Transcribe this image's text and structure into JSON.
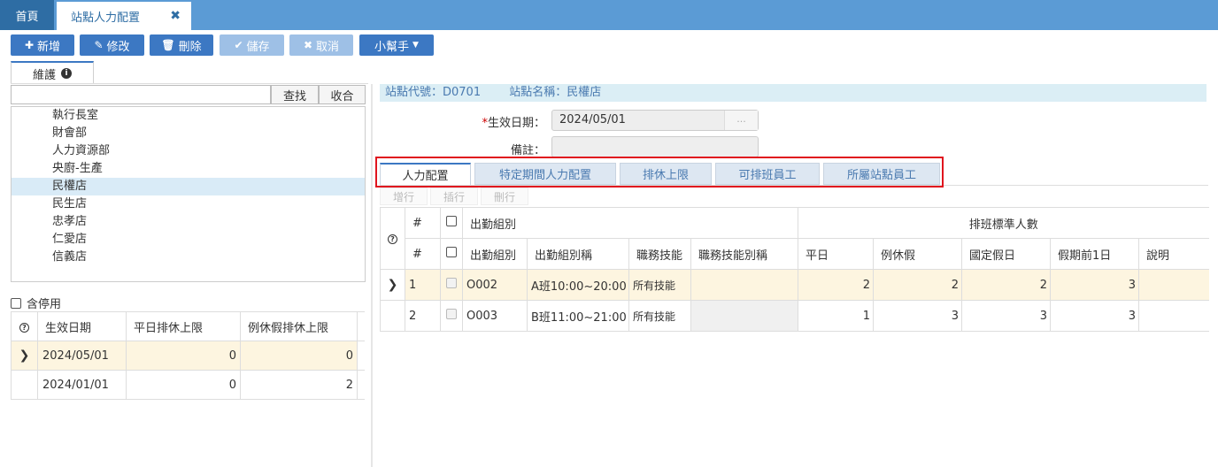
{
  "tabs": {
    "home": "首頁",
    "active": "站點人力配置"
  },
  "toolbar": {
    "add": "新增",
    "edit": "修改",
    "delete": "刪除",
    "save": "儲存",
    "cancel": "取消",
    "helper": "小幫手"
  },
  "left": {
    "subtab": "維護",
    "search_value": "",
    "find": "查找",
    "collapse": "收合",
    "tree": [
      "執行長室",
      "財會部",
      "人力資源部",
      "央廚-生產",
      "民權店",
      "民生店",
      "忠孝店",
      "仁愛店",
      "信義店"
    ],
    "selected_index": 4,
    "include_disabled": "含停用",
    "table": {
      "headers": [
        "生效日期",
        "平日排休上限",
        "例休假排休上限"
      ],
      "rows": [
        {
          "date": "2024/05/01",
          "weekday": "0",
          "holiday": "0"
        },
        {
          "date": "2024/01/01",
          "weekday": "0",
          "holiday": "2"
        }
      ]
    }
  },
  "right": {
    "station_code": "站點代號：D0701",
    "station_name": "站點名稱：民權店",
    "effective_label": "生效日期：",
    "effective_value": "2024/05/01",
    "effective_btn": "...",
    "note_label": "備註：",
    "tabs": [
      "人力配置",
      "特定期間人力配置",
      "排休上限",
      "可排班員工",
      "所屬站點員工"
    ],
    "grid_buttons": [
      "增行",
      "插行",
      "刪行"
    ],
    "grid": {
      "group_header": "出勤組別",
      "group_header2": "排班標準人數",
      "headers": [
        "#",
        "出勤組別",
        "出勤組別稱",
        "職務技能",
        "職務技能別稱",
        "平日",
        "例休假",
        "國定假日",
        "假期前1日",
        "說明"
      ],
      "rows": [
        {
          "n": "1",
          "code": "O002",
          "name": "A班10:00~20:00",
          "skill": "所有技能",
          "skill_alias": "",
          "weekday": "2",
          "rest": "2",
          "national": "2",
          "before": "3",
          "note": ""
        },
        {
          "n": "2",
          "code": "O003",
          "name": "B班11:00~21:00",
          "skill": "所有技能",
          "skill_alias": "",
          "weekday": "1",
          "rest": "3",
          "national": "3",
          "before": "3",
          "note": ""
        }
      ]
    }
  }
}
